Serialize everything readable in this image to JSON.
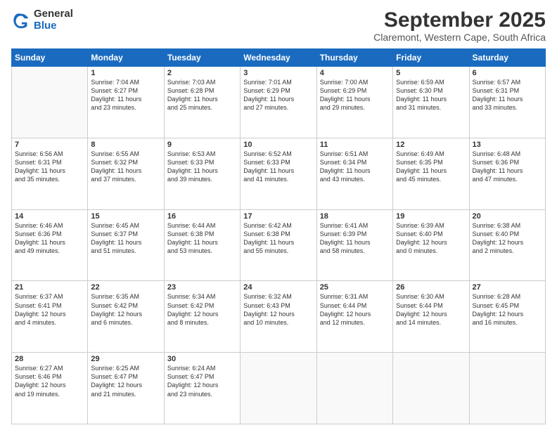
{
  "logo": {
    "general": "General",
    "blue": "Blue"
  },
  "title": "September 2025",
  "subtitle": "Claremont, Western Cape, South Africa",
  "days": [
    "Sunday",
    "Monday",
    "Tuesday",
    "Wednesday",
    "Thursday",
    "Friday",
    "Saturday"
  ],
  "weeks": [
    [
      {
        "num": "",
        "info": ""
      },
      {
        "num": "1",
        "info": "Sunrise: 7:04 AM\nSunset: 6:27 PM\nDaylight: 11 hours\nand 23 minutes."
      },
      {
        "num": "2",
        "info": "Sunrise: 7:03 AM\nSunset: 6:28 PM\nDaylight: 11 hours\nand 25 minutes."
      },
      {
        "num": "3",
        "info": "Sunrise: 7:01 AM\nSunset: 6:29 PM\nDaylight: 11 hours\nand 27 minutes."
      },
      {
        "num": "4",
        "info": "Sunrise: 7:00 AM\nSunset: 6:29 PM\nDaylight: 11 hours\nand 29 minutes."
      },
      {
        "num": "5",
        "info": "Sunrise: 6:59 AM\nSunset: 6:30 PM\nDaylight: 11 hours\nand 31 minutes."
      },
      {
        "num": "6",
        "info": "Sunrise: 6:57 AM\nSunset: 6:31 PM\nDaylight: 11 hours\nand 33 minutes."
      }
    ],
    [
      {
        "num": "7",
        "info": "Sunrise: 6:56 AM\nSunset: 6:31 PM\nDaylight: 11 hours\nand 35 minutes."
      },
      {
        "num": "8",
        "info": "Sunrise: 6:55 AM\nSunset: 6:32 PM\nDaylight: 11 hours\nand 37 minutes."
      },
      {
        "num": "9",
        "info": "Sunrise: 6:53 AM\nSunset: 6:33 PM\nDaylight: 11 hours\nand 39 minutes."
      },
      {
        "num": "10",
        "info": "Sunrise: 6:52 AM\nSunset: 6:33 PM\nDaylight: 11 hours\nand 41 minutes."
      },
      {
        "num": "11",
        "info": "Sunrise: 6:51 AM\nSunset: 6:34 PM\nDaylight: 11 hours\nand 43 minutes."
      },
      {
        "num": "12",
        "info": "Sunrise: 6:49 AM\nSunset: 6:35 PM\nDaylight: 11 hours\nand 45 minutes."
      },
      {
        "num": "13",
        "info": "Sunrise: 6:48 AM\nSunset: 6:36 PM\nDaylight: 11 hours\nand 47 minutes."
      }
    ],
    [
      {
        "num": "14",
        "info": "Sunrise: 6:46 AM\nSunset: 6:36 PM\nDaylight: 11 hours\nand 49 minutes."
      },
      {
        "num": "15",
        "info": "Sunrise: 6:45 AM\nSunset: 6:37 PM\nDaylight: 11 hours\nand 51 minutes."
      },
      {
        "num": "16",
        "info": "Sunrise: 6:44 AM\nSunset: 6:38 PM\nDaylight: 11 hours\nand 53 minutes."
      },
      {
        "num": "17",
        "info": "Sunrise: 6:42 AM\nSunset: 6:38 PM\nDaylight: 11 hours\nand 55 minutes."
      },
      {
        "num": "18",
        "info": "Sunrise: 6:41 AM\nSunset: 6:39 PM\nDaylight: 11 hours\nand 58 minutes."
      },
      {
        "num": "19",
        "info": "Sunrise: 6:39 AM\nSunset: 6:40 PM\nDaylight: 12 hours\nand 0 minutes."
      },
      {
        "num": "20",
        "info": "Sunrise: 6:38 AM\nSunset: 6:40 PM\nDaylight: 12 hours\nand 2 minutes."
      }
    ],
    [
      {
        "num": "21",
        "info": "Sunrise: 6:37 AM\nSunset: 6:41 PM\nDaylight: 12 hours\nand 4 minutes."
      },
      {
        "num": "22",
        "info": "Sunrise: 6:35 AM\nSunset: 6:42 PM\nDaylight: 12 hours\nand 6 minutes."
      },
      {
        "num": "23",
        "info": "Sunrise: 6:34 AM\nSunset: 6:42 PM\nDaylight: 12 hours\nand 8 minutes."
      },
      {
        "num": "24",
        "info": "Sunrise: 6:32 AM\nSunset: 6:43 PM\nDaylight: 12 hours\nand 10 minutes."
      },
      {
        "num": "25",
        "info": "Sunrise: 6:31 AM\nSunset: 6:44 PM\nDaylight: 12 hours\nand 12 minutes."
      },
      {
        "num": "26",
        "info": "Sunrise: 6:30 AM\nSunset: 6:44 PM\nDaylight: 12 hours\nand 14 minutes."
      },
      {
        "num": "27",
        "info": "Sunrise: 6:28 AM\nSunset: 6:45 PM\nDaylight: 12 hours\nand 16 minutes."
      }
    ],
    [
      {
        "num": "28",
        "info": "Sunrise: 6:27 AM\nSunset: 6:46 PM\nDaylight: 12 hours\nand 19 minutes."
      },
      {
        "num": "29",
        "info": "Sunrise: 6:25 AM\nSunset: 6:47 PM\nDaylight: 12 hours\nand 21 minutes."
      },
      {
        "num": "30",
        "info": "Sunrise: 6:24 AM\nSunset: 6:47 PM\nDaylight: 12 hours\nand 23 minutes."
      },
      {
        "num": "",
        "info": ""
      },
      {
        "num": "",
        "info": ""
      },
      {
        "num": "",
        "info": ""
      },
      {
        "num": "",
        "info": ""
      }
    ]
  ]
}
